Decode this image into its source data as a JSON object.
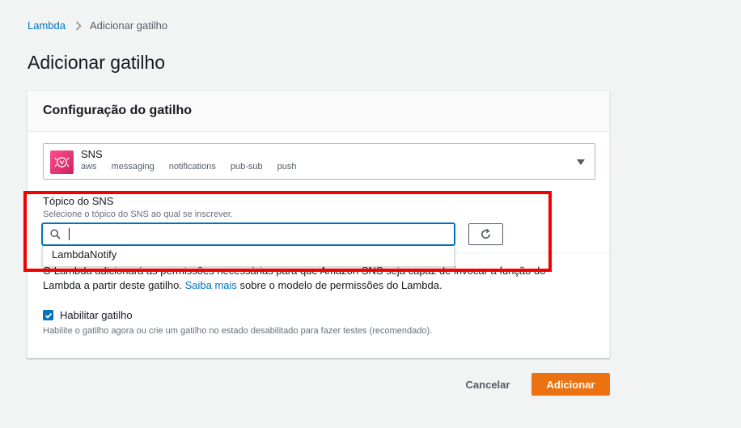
{
  "breadcrumb": {
    "parent": "Lambda",
    "current": "Adicionar gatilho"
  },
  "page": {
    "title": "Adicionar gatilho"
  },
  "panel": {
    "title": "Configuração do gatilho"
  },
  "service": {
    "name": "SNS",
    "tags": [
      "aws",
      "messaging",
      "notifications",
      "pub-sub",
      "push"
    ],
    "icon": "sns-logo-icon"
  },
  "topic": {
    "label": "Tópico do SNS",
    "description": "Selecione o tópico do SNS ao qual se inscrever.",
    "search_value": "",
    "options": [
      "LambdaNotify"
    ]
  },
  "permissions": {
    "text_before": "O Lambda adicionará as permissões necessárias para que Amazon SNS seja capaz de invocar a função do Lambda a partir deste gatilho. ",
    "link": "Saiba mais",
    "text_after": " sobre o modelo de permissões do Lambda."
  },
  "enable_trigger": {
    "label": "Habilitar gatilho",
    "checked": true,
    "description": "Habilite o gatilho agora ou crie um gatilho no estado desabilitado para fazer testes (recomendado)."
  },
  "footer": {
    "cancel_label": "Cancelar",
    "add_label": "Adicionar"
  },
  "colors": {
    "accent": "#0073bb",
    "primary_button": "#ec7211",
    "highlight": "#f30000"
  }
}
